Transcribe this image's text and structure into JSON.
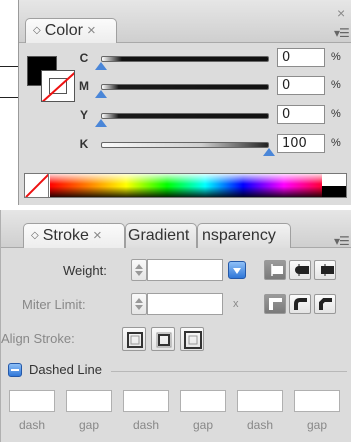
{
  "color_panel": {
    "tab_label": "Color",
    "close_glyph": "×",
    "window_close": "×",
    "menu_glyph": "▾☰",
    "fill_color": "#000000",
    "sliders": [
      {
        "label": "C",
        "value": "0",
        "unit": "%",
        "position": 0,
        "gradient": "linear-gradient(to right,#fff,#111)"
      },
      {
        "label": "M",
        "value": "0",
        "unit": "%",
        "position": 0,
        "gradient": "linear-gradient(to right,#fff,#111)"
      },
      {
        "label": "Y",
        "value": "0",
        "unit": "%",
        "position": 0,
        "gradient": "linear-gradient(to right,#fff,#111)"
      },
      {
        "label": "K",
        "value": "100",
        "unit": "%",
        "position": 100,
        "gradient": "linear-gradient(to right,#fff,#111)"
      }
    ]
  },
  "stroke_panel": {
    "tabs": [
      {
        "label": "Stroke",
        "close": "×"
      },
      {
        "label": "Gradient"
      },
      {
        "label": "nsparency"
      }
    ],
    "menu_glyph": "▾☰",
    "weight_label": "Weight:",
    "miter_label": "Miter Limit:",
    "miter_unit": "x",
    "align_label": "Align Stroke:",
    "dashed_label": "Dashed Line",
    "dash_labels": [
      "dash",
      "gap",
      "dash",
      "gap",
      "dash",
      "gap"
    ]
  },
  "accent_color": "#2f77d8"
}
